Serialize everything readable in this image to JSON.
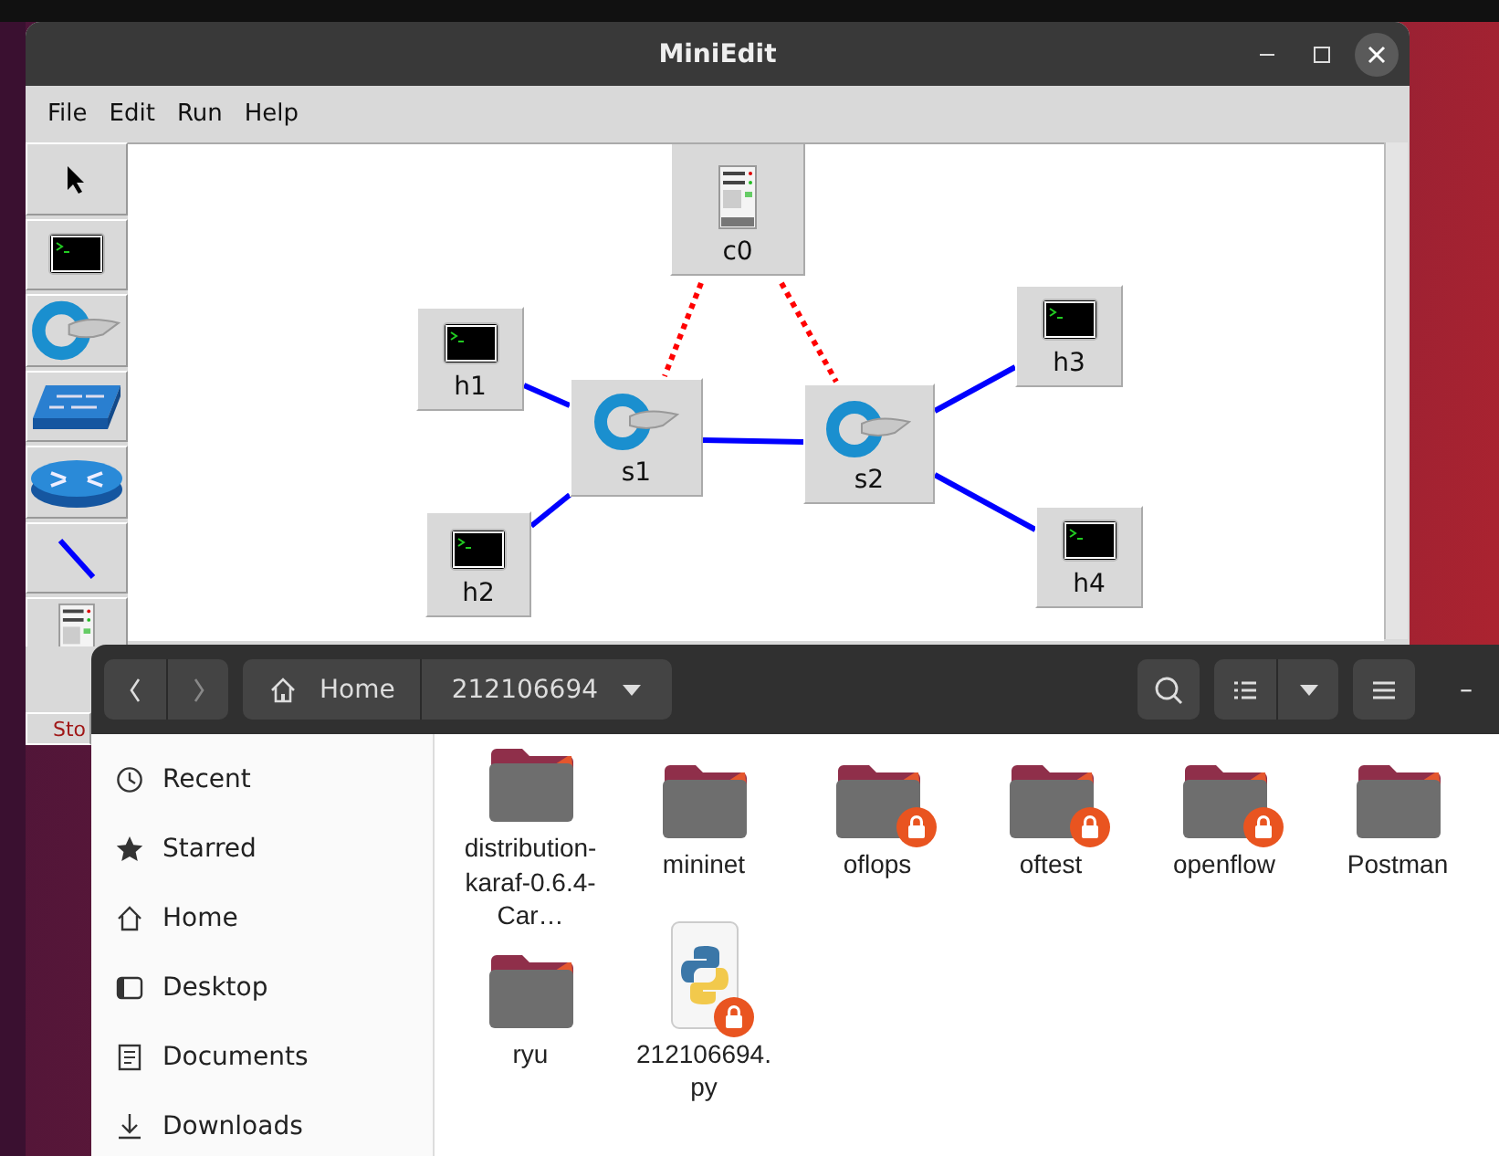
{
  "miniedit": {
    "title": "MiniEdit",
    "menu": [
      "File",
      "Edit",
      "Run",
      "Help"
    ],
    "tools": [
      {
        "kind": "select"
      },
      {
        "kind": "host"
      },
      {
        "kind": "switch"
      },
      {
        "kind": "legacy-switch"
      },
      {
        "kind": "router"
      },
      {
        "kind": "link"
      },
      {
        "kind": "controller"
      }
    ],
    "stop_button": "Sto",
    "nodes": [
      {
        "label": "c0",
        "kind": "controller"
      },
      {
        "label": "h1",
        "kind": "host"
      },
      {
        "label": "s1",
        "kind": "switch"
      },
      {
        "label": "s2",
        "kind": "switch"
      },
      {
        "label": "h3",
        "kind": "host"
      },
      {
        "label": "h2",
        "kind": "host"
      },
      {
        "label": "h4",
        "kind": "host"
      }
    ],
    "links": [
      {
        "kind": "data"
      },
      {
        "kind": "data"
      },
      {
        "kind": "data"
      },
      {
        "kind": "data"
      },
      {
        "kind": "data"
      },
      {
        "kind": "control"
      },
      {
        "kind": "control"
      }
    ]
  },
  "files": {
    "path": [
      {
        "label": "Home",
        "selected": false
      },
      {
        "label": "212106694",
        "selected": true
      }
    ],
    "minimize": "–",
    "sidebar": [
      {
        "label": "Recent",
        "kind": "recent"
      },
      {
        "label": "Starred",
        "kind": "starred"
      },
      {
        "label": "Home",
        "kind": "home"
      },
      {
        "label": "Desktop",
        "kind": "desktop"
      },
      {
        "label": "Documents",
        "kind": "documents"
      },
      {
        "label": "Downloads",
        "kind": "downloads"
      }
    ],
    "items": [
      {
        "name": "distribution-karaf-0.6.4-Car…",
        "kind": "folder",
        "locked": false
      },
      {
        "name": "mininet",
        "kind": "folder",
        "locked": false
      },
      {
        "name": "oflops",
        "kind": "folder",
        "locked": true
      },
      {
        "name": "oftest",
        "kind": "folder",
        "locked": true
      },
      {
        "name": "openflow",
        "kind": "folder",
        "locked": true
      },
      {
        "name": "Postman",
        "kind": "folder",
        "locked": false
      },
      {
        "name": "ryu",
        "kind": "folder",
        "locked": false
      },
      {
        "name": "212106694.py",
        "kind": "python",
        "locked": true
      }
    ]
  }
}
